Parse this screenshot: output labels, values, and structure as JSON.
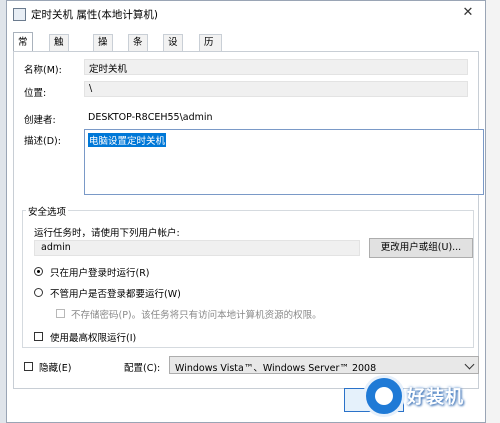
{
  "window": {
    "title": "定时关机 属性(本地计算机)"
  },
  "tabs": [
    {
      "label": "常规"
    },
    {
      "label": "触发器"
    },
    {
      "label": "操作"
    },
    {
      "label": "条件"
    },
    {
      "label": "设置"
    },
    {
      "label": "历史记录(已禁用)"
    }
  ],
  "general": {
    "name_label": "名称(M):",
    "name_value": "定时关机",
    "location_label": "位置:",
    "location_value": "\\",
    "author_label": "创建者:",
    "author_value": "DESKTOP-R8CEH55\\admin",
    "description_label": "描述(D):",
    "description_value": "电脑设置定时关机"
  },
  "security": {
    "title": "安全选项",
    "run_as_prompt": "运行任务时，请使用下列用户帐户:",
    "user": "admin",
    "change_user_button": "更改用户或组(U)...",
    "radio_logged_on": "只在用户登录时运行(R)",
    "radio_logged_on_selected": true,
    "radio_whether_logged": "不管用户是否登录都要运行(W)",
    "do_not_store_password": "不存储密码(P)。该任务将只有访问本地计算机资源的权限。",
    "highest_privileges": "使用最高权限运行(I)"
  },
  "bottom": {
    "hidden_label": "隐藏(E)",
    "configure_label": "配置(C):",
    "configure_value": "Windows Vista™、Windows Server™ 2008"
  },
  "watermark": {
    "text": "好装机"
  },
  "colors": {
    "selection": "#0078d7",
    "watermark_blue": "#1f7ad6"
  }
}
